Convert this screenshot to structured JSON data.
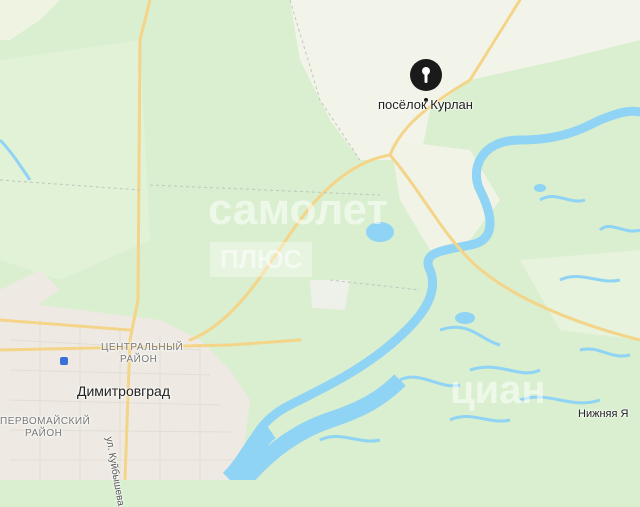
{
  "map": {
    "pin_label": "посёлок Курлан",
    "pin_icon": "map-pin-icon",
    "city": "Димитровград",
    "districts": [
      "ЦЕНТРАЛЬНЫЙ",
      "РАЙОН",
      "ПЕРВОМАЙСКИЙ",
      "РАЙОН"
    ],
    "street": "ул. Куйбышева",
    "partial_village": "Нижняя Я",
    "watermark_samolet": "самолет",
    "watermark_plus": "ПЛЮС",
    "watermark_cian": "циан",
    "colors": {
      "forest": "#d9efcf",
      "field": "#f3f4e9",
      "water": "#8fd3f5",
      "road": "#f4d488",
      "town": "#eeeae3",
      "pin": "#1a1a1a"
    }
  }
}
